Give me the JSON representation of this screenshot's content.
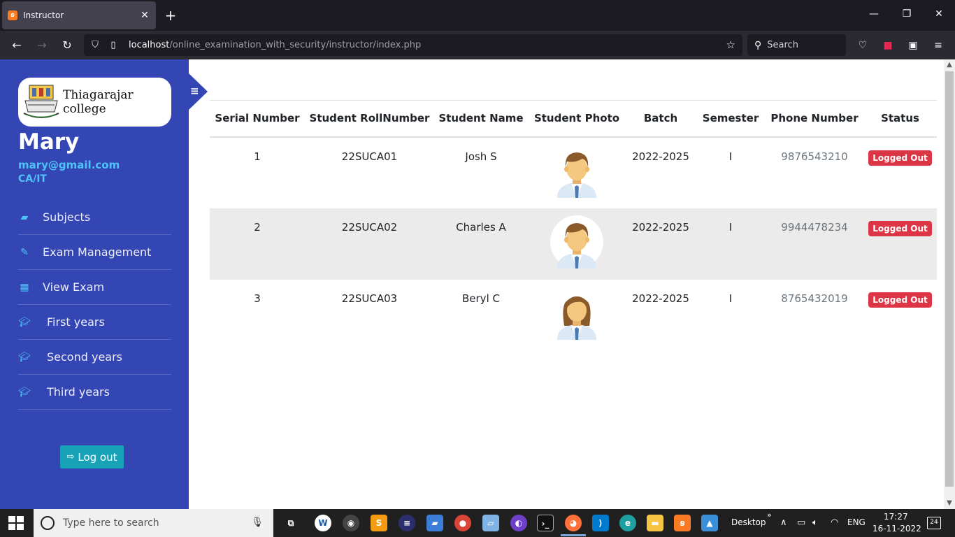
{
  "browser": {
    "tab_title": "Instructor",
    "url_host": "localhost",
    "url_path": "/online_examination_with_security/instructor/index.php",
    "search_placeholder": "Search"
  },
  "sidebar": {
    "college_name": "Thiagarajar college",
    "user_name": "Mary",
    "user_email": "mary@gmail.com",
    "user_dept": "CA/IT",
    "menu": [
      {
        "label": "Subjects",
        "icon": "book-icon"
      },
      {
        "label": "Exam Management",
        "icon": "pencil-icon"
      },
      {
        "label": "View Exam",
        "icon": "table-icon"
      },
      {
        "label": "First years",
        "icon": "graduation-cap-icon"
      },
      {
        "label": "Second years",
        "icon": "graduation-cap-icon"
      },
      {
        "label": "Third years",
        "icon": "graduation-cap-icon"
      }
    ],
    "logout_label": "Log out"
  },
  "table": {
    "headers": [
      "Serial Number",
      "Student RollNumber",
      "Student Name",
      "Student Photo",
      "Batch",
      "Semester",
      "Phone Number",
      "Status"
    ],
    "rows": [
      {
        "serial": "1",
        "roll": "22SUCA01",
        "name": "Josh S",
        "photo": "male-avatar",
        "batch": "2022-2025",
        "semester": "I",
        "phone": "9876543210",
        "status": "Logged Out"
      },
      {
        "serial": "2",
        "roll": "22SUCA02",
        "name": "Charles A",
        "photo": "male-avatar",
        "batch": "2022-2025",
        "semester": "I",
        "phone": "9944478234",
        "status": "Logged Out"
      },
      {
        "serial": "3",
        "roll": "22SUCA03",
        "name": "Beryl C",
        "photo": "female-avatar",
        "batch": "2022-2025",
        "semester": "I",
        "phone": "8765432019",
        "status": "Logged Out"
      }
    ]
  },
  "taskbar": {
    "search_placeholder": "Type here to search",
    "desktop_label": "Desktop",
    "language": "ENG",
    "time": "17:27",
    "date": "16-11-2022",
    "notification_count": "24"
  },
  "colors": {
    "sidebar": "#3445b4",
    "accent": "#4fc3f7",
    "logout": "#17a2b8",
    "status_badge": "#dc3545"
  }
}
